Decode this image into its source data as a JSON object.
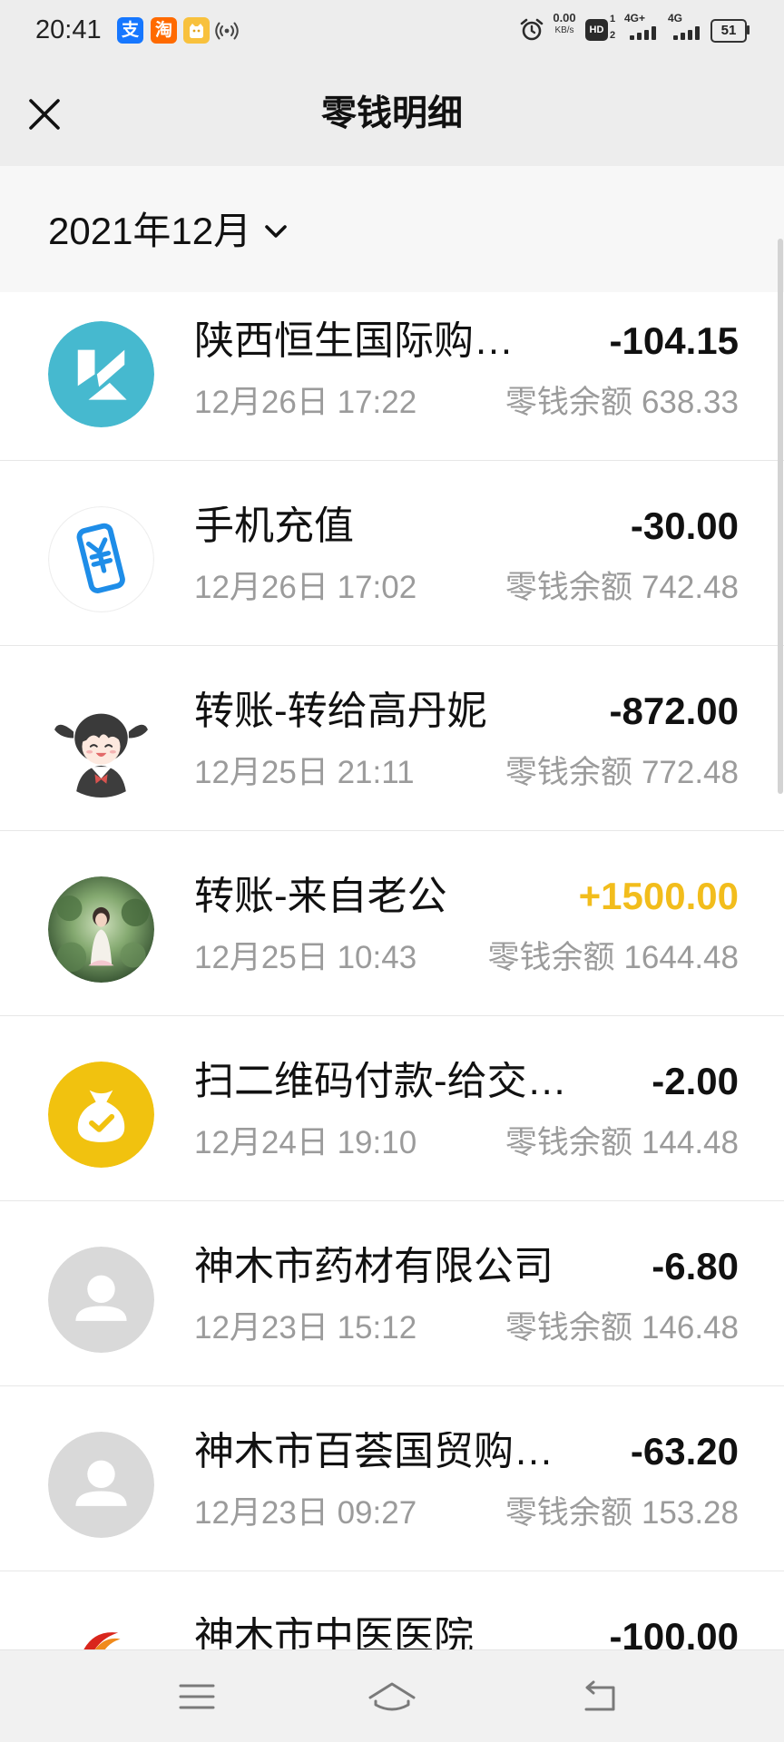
{
  "status_bar": {
    "time": "20:41",
    "notification_apps": [
      {
        "label": "支",
        "icon": "alipay-icon",
        "color": "#1677ff"
      },
      {
        "label": "淘",
        "icon": "taobao-icon",
        "color": "#ff6a00"
      },
      {
        "icon": "app-notification-icon",
        "color": "#f8c13d"
      },
      {
        "icon": "hotspot-icon"
      }
    ],
    "alarm_icon": "alarm-clock-icon",
    "net_speed": "0.00",
    "net_speed_unit": "KB/s",
    "hd_label": "HD",
    "hd_sim_1": "1",
    "hd_sim_2": "2",
    "sim1_network": "4G+",
    "sim2_network": "4G",
    "battery": "51"
  },
  "header": {
    "title": "零钱明细",
    "close_icon": "close-icon"
  },
  "filter": {
    "month": "2021年12月",
    "dropdown_icon": "chevron-down-icon"
  },
  "list": {
    "balance_label": "零钱余额"
  },
  "transactions": [
    {
      "title": "陕西恒生国际购…",
      "datetime": "12月26日 17:22",
      "balance": "638.33",
      "amount": "-104.15",
      "amount_color": "#111111",
      "avatar": "merchant-logo-icon"
    },
    {
      "title": "手机充值",
      "datetime": "12月26日 17:02",
      "balance": "742.48",
      "amount": "-30.00",
      "amount_color": "#111111",
      "avatar": "phone-recharge-icon"
    },
    {
      "title": "转账-转给高丹妮",
      "datetime": "12月25日 21:11",
      "balance": "772.48",
      "amount": "-872.00",
      "amount_color": "#111111",
      "avatar": "user-avatar"
    },
    {
      "title": "转账-来自老公",
      "datetime": "12月25日 10:43",
      "balance": "1644.48",
      "amount": "+1500.00",
      "amount_color": "#f2bd1c",
      "avatar": "user-avatar"
    },
    {
      "title": "扫二维码付款-给交…",
      "datetime": "12月24日 19:10",
      "balance": "144.48",
      "amount": "-2.00",
      "amount_color": "#111111",
      "avatar": "money-bag-icon"
    },
    {
      "title": "神木市药材有限公司",
      "datetime": "12月23日 15:12",
      "balance": "146.48",
      "amount": "-6.80",
      "amount_color": "#111111",
      "avatar": "default-user-icon"
    },
    {
      "title": "神木市百荟国贸购…",
      "datetime": "12月23日 09:27",
      "balance": "153.28",
      "amount": "-63.20",
      "amount_color": "#111111",
      "avatar": "default-user-icon"
    },
    {
      "title": "神木市中医医院",
      "amount": "-100.00",
      "amount_color": "#111111",
      "avatar": "hospital-logo-icon"
    }
  ],
  "bottom_nav": {
    "items": [
      {
        "icon": "menu-icon"
      },
      {
        "icon": "home-icon"
      },
      {
        "icon": "back-icon"
      }
    ]
  },
  "colors": {
    "header_bg": "#ededed",
    "filter_bg": "#f7f7f7",
    "nav_bg": "#f1f1f1",
    "secondary_text": "#9b9b9b",
    "income": "#f2bd1c",
    "expense": "#111111"
  }
}
